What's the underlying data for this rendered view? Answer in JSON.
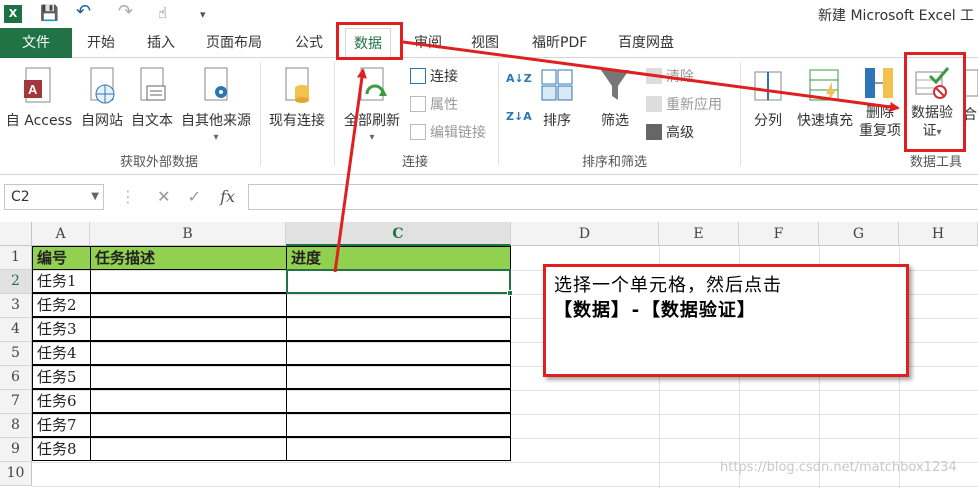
{
  "window": {
    "title": "新建 Microsoft Excel 工"
  },
  "quick_access": {
    "app_icon": "X",
    "save": "💾",
    "undo": "↶",
    "redo": "↷",
    "touch": "☝",
    "more": "▾"
  },
  "tabs": {
    "file": "文件",
    "items": [
      "开始",
      "插入",
      "页面布局",
      "公式",
      "数据",
      "审阅",
      "视图",
      "福昕PDF",
      "百度网盘"
    ],
    "active": "数据"
  },
  "ribbon": {
    "get_external": {
      "from_access": "自 Access",
      "from_web": "自网站",
      "from_text": "自文本",
      "from_other": "自其他来源",
      "label": "获取外部数据"
    },
    "existing_connections": "现有连接",
    "connections": {
      "refresh_all": "全部刷新",
      "connections": "连接",
      "properties": "属性",
      "edit_links": "编辑链接",
      "label": "连接"
    },
    "sort_filter": {
      "sort": "排序",
      "filter": "筛选",
      "clear": "清除",
      "reapply": "重新应用",
      "advanced": "高级",
      "label": "排序和筛选"
    },
    "data_tools": {
      "text_to_columns": "分列",
      "flash_fill": "快速填充",
      "remove_duplicates_1": "删除",
      "remove_duplicates_2": "重复项",
      "data_validation_1": "数据验",
      "data_validation_2": "证",
      "consolidate": "合",
      "label": "数据工具"
    }
  },
  "formula_bar": {
    "name_box": "C2",
    "fx": "fx",
    "cancel": "✕",
    "enter": "✓",
    "value": ""
  },
  "sheet": {
    "columns": [
      "A",
      "B",
      "C",
      "D",
      "E",
      "F",
      "G",
      "H"
    ],
    "rows": [
      "1",
      "2",
      "3",
      "4",
      "5",
      "6",
      "7",
      "8",
      "9",
      "10"
    ],
    "selected_cell": "C2",
    "header": [
      "编号",
      "任务描述",
      "进度"
    ],
    "tasks": [
      "任务1",
      "任务2",
      "任务3",
      "任务4",
      "任务5",
      "任务6",
      "任务7",
      "任务8"
    ]
  },
  "annotation": {
    "line1": "选择一个单元格，然后点击",
    "line2": "【数据】-【数据验证】",
    "color": "#e02020"
  },
  "watermark": "https://blog.csdn.net/matchbox1234"
}
